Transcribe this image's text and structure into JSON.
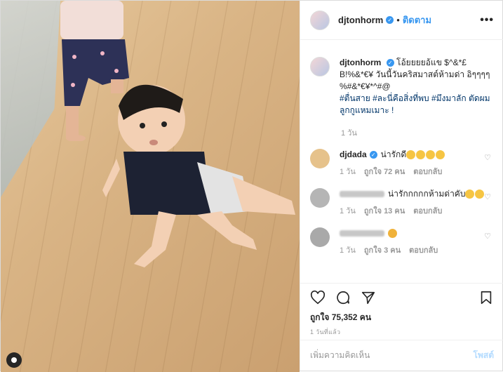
{
  "post": {
    "username": "djtonhorm",
    "follow_label": "ติดตาม",
    "more_label": "•••"
  },
  "caption": {
    "username": "djtonhorm",
    "text": "โอ้ยยยยอ้แข $^&*£ B!%&*€¥ วันนี้วันคริสมาสต์ห้ามด่า อิๆๆๆๆ %#&*€¥*^#@",
    "tags": "#ตื่นสาย #ละนี่คือสิ่งที่พบ #มึงมาลัก ตัดผมลูกกูแหมเมาะ !",
    "time": "1 วัน"
  },
  "comments": [
    {
      "user": "djdada",
      "text": "น่ารักดี",
      "emoji_count": 4,
      "time": "1 วัน",
      "likes": "ถูกใจ 72 คน",
      "reply": "ตอบกลับ",
      "avatar_color": "#e6c28b"
    },
    {
      "user": "",
      "text": "น่ารักกกกกห้ามด่าคับ",
      "emoji_count": 2,
      "time": "1 วัน",
      "likes": "ถูกใจ 13 คน",
      "reply": "ตอบกลับ",
      "avatar_color": "#b5b5b5"
    },
    {
      "user": "",
      "text": "",
      "emoji_count": 1,
      "time": "1 วัน",
      "likes": "ถูกใจ 3 คน",
      "reply": "ตอบกลับ",
      "avatar_color": "#a9a9a9"
    }
  ],
  "likes_label": "ถูกใจ 75,352 คน",
  "posted_label": "1 วันที่แล้ว",
  "add_comment": {
    "placeholder": "เพิ่มความคิดเห็น",
    "post_label": "โพสต์"
  },
  "colors": {
    "accent": "#3897f0",
    "muted": "#999999",
    "tag": "#003569"
  }
}
